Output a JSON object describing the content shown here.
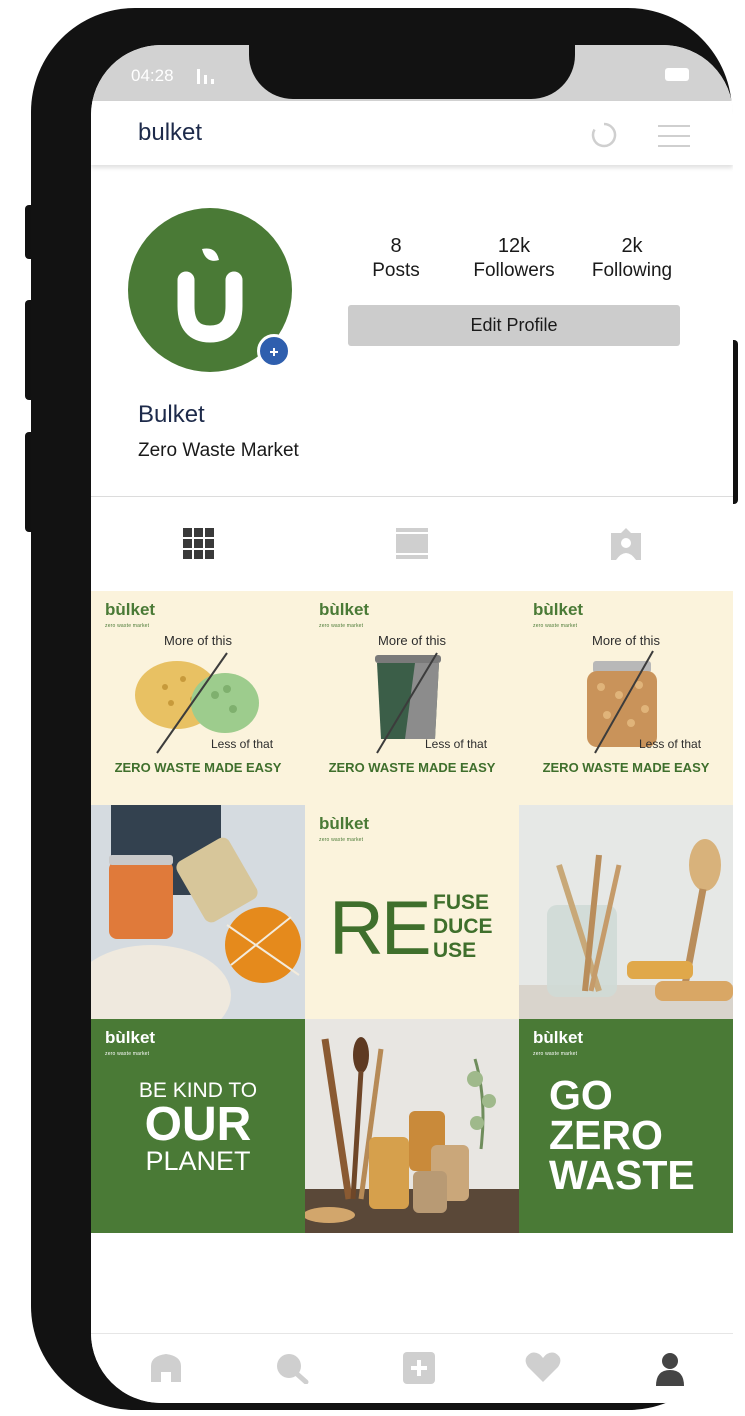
{
  "status": {
    "time": "04:28"
  },
  "appbar": {
    "title": "bulket"
  },
  "profile": {
    "name": "Bulket",
    "bio": "Zero Waste Market",
    "stats": [
      {
        "value": "8",
        "label": "Posts"
      },
      {
        "value": "12k",
        "label": "Followers"
      },
      {
        "value": "2k",
        "label": "Following"
      }
    ],
    "edit_label": "Edit Profile"
  },
  "posts": [
    {
      "logo": "bùlket",
      "tagline": "zero waste market",
      "top": "More of this",
      "bottom": "Less of that",
      "footer": "ZERO WASTE MADE EASY"
    },
    {
      "logo": "bùlket",
      "tagline": "zero waste market",
      "top": "More of this",
      "bottom": "Less of that",
      "footer": "ZERO WASTE MADE EASY"
    },
    {
      "logo": "bùlket",
      "tagline": "zero waste market",
      "top": "More of this",
      "bottom": "Less of that",
      "footer": "ZERO WASTE MADE EASY"
    },
    {
      "logo": "bùlket",
      "tagline": "zero waste market",
      "big": "RE",
      "words": [
        "FUSE",
        "DUCE",
        "USE"
      ]
    },
    {
      "logo": "bùlket",
      "tagline": "zero waste market",
      "lines": [
        "BE KIND TO",
        "OUR",
        "PLANET"
      ]
    },
    {
      "logo": "bùlket",
      "tagline": "zero waste market",
      "lines": [
        "GO",
        "ZERO",
        "WASTE"
      ]
    }
  ],
  "colors": {
    "brand_green": "#4a7a36",
    "cream": "#fbf3dc",
    "badge_blue": "#2f5fae",
    "nav_icon": "#cfcfcf"
  },
  "icons": {
    "avatar_logo": "bulket-u-logo",
    "tabs": [
      "grid-icon",
      "feed-icon",
      "tagged-icon"
    ],
    "nav": [
      "home-icon",
      "search-icon",
      "add-post-icon",
      "heart-icon",
      "profile-icon"
    ]
  }
}
